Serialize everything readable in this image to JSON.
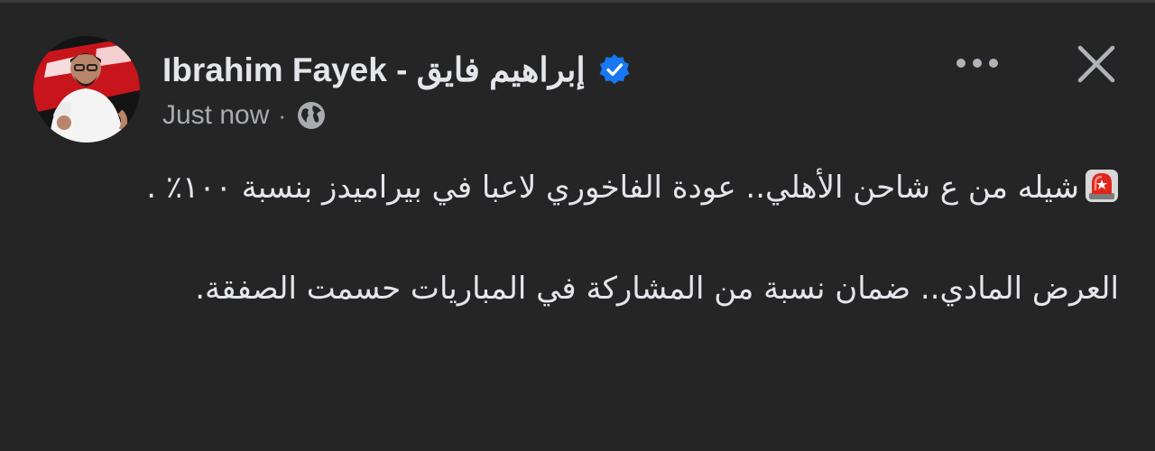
{
  "post": {
    "author_name": "Ibrahim Fayek - إبراهيم  فايق",
    "timestamp": "Just now",
    "separator": "·",
    "audience_icon": "globe-icon",
    "verified_icon": "verified-badge-icon",
    "more_icon": "more-options-icon",
    "close_icon": "close-icon",
    "paragraph_1_emoji": "siren-emoji",
    "paragraph_1_text": "شيله من ع شاحن الأهلي.. عودة الفاخوري لاعبا في بيراميدز بنسبة ١٠٠٪ .",
    "paragraph_2_text": "العرض المادي.. ضمان نسبة من المشاركة في المباريات حسمت الصفقة."
  },
  "colors": {
    "background": "#252526",
    "text_primary": "#e4e6eb",
    "text_secondary": "#a8abb0",
    "verified_blue": "#1877f2"
  }
}
